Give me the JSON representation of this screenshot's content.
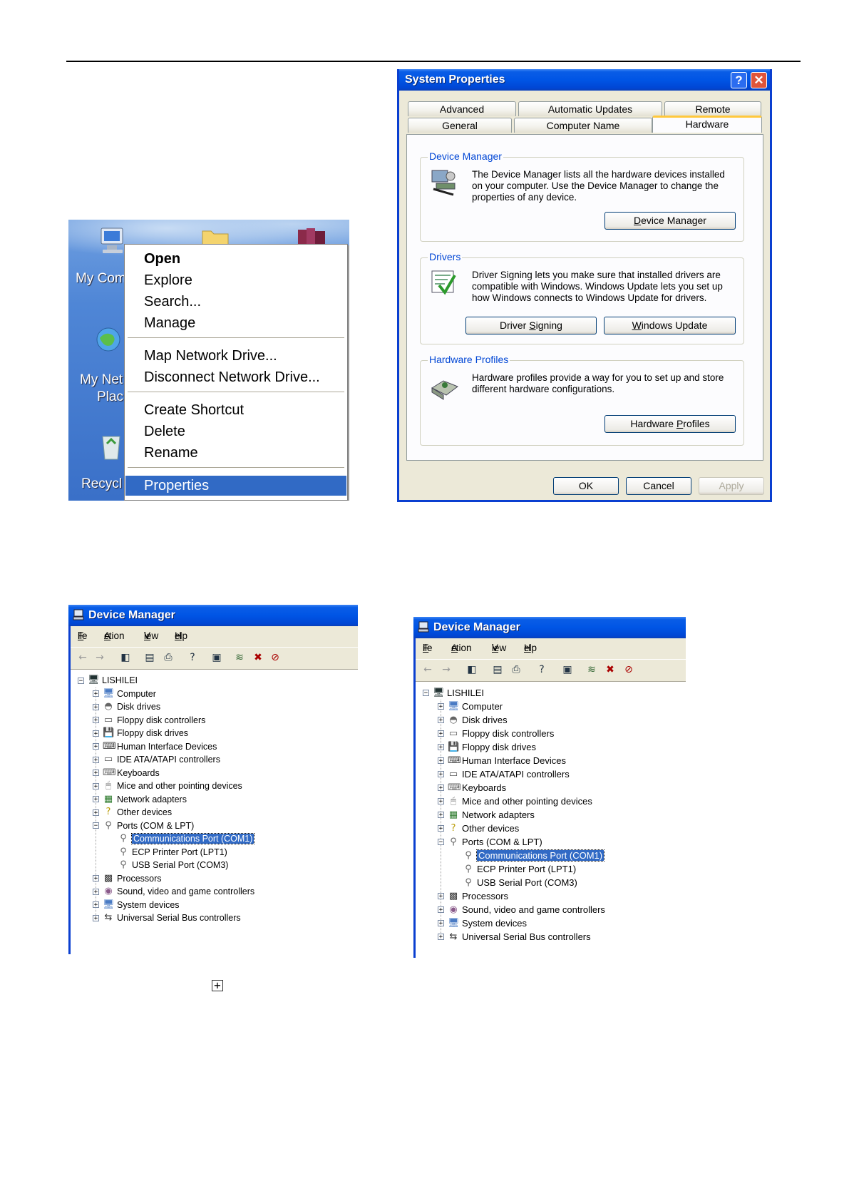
{
  "context_menu": {
    "items": [
      {
        "label": "Open",
        "bold": true
      },
      {
        "label": "Explore"
      },
      {
        "label": "Search..."
      },
      {
        "label": "Manage"
      },
      {
        "label": "Map Network Drive..."
      },
      {
        "label": "Disconnect Network Drive..."
      },
      {
        "label": "Create Shortcut"
      },
      {
        "label": "Delete"
      },
      {
        "label": "Rename"
      },
      {
        "label": "Properties",
        "selected": true
      }
    ],
    "desktop_labels": [
      "My Com",
      "My Net",
      "Plac",
      "Recycl"
    ]
  },
  "system_properties": {
    "title": "System Properties",
    "help_button": "?",
    "close_button": "✕",
    "tabs_back": [
      "Advanced",
      "Automatic Updates",
      "Remote"
    ],
    "tabs_front": [
      "General",
      "Computer Name",
      "Hardware"
    ],
    "active_tab": "Hardware",
    "device_manager": {
      "title": "Device Manager",
      "text": "The Device Manager lists all the hardware devices installed on your computer. Use the Device Manager to change the properties of any device.",
      "button_pre": "",
      "button_u": "D",
      "button_post": "evice Manager"
    },
    "drivers": {
      "title": "Drivers",
      "text": "Driver Signing lets you make sure that installed drivers are compatible with Windows. Windows Update lets you set up how Windows connects to Windows Update for drivers.",
      "signing_pre": "Driver ",
      "signing_u": "S",
      "signing_post": "igning",
      "update_pre": "",
      "update_u": "W",
      "update_post": "indows Update"
    },
    "hardware_profiles": {
      "title": "Hardware Profiles",
      "text": "Hardware profiles provide a way for you to set up and store different hardware configurations.",
      "button_pre": "Hardware ",
      "button_u": "P",
      "button_post": "rofiles"
    },
    "ok_label": "OK",
    "cancel_label": "Cancel",
    "apply_label": "Apply"
  },
  "device_manager_window": {
    "title": "Device Manager",
    "menu": [
      {
        "u": "F",
        "rest": "ile"
      },
      {
        "u": "A",
        "rest": "ction"
      },
      {
        "u": "V",
        "rest": "iew"
      },
      {
        "u": "H",
        "rest": "elp"
      }
    ],
    "root": "LISHILEI",
    "categories": [
      "Computer",
      "Disk drives",
      "Floppy disk controllers",
      "Floppy disk drives",
      "Human Interface Devices",
      "IDE ATA/ATAPI controllers",
      "Keyboards",
      "Mice and other pointing devices",
      "Network adapters",
      "Other devices",
      "Ports (COM & LPT)",
      "Processors",
      "Sound, video and game controllers",
      "System devices",
      "Universal Serial Bus controllers"
    ],
    "ports": [
      "Communications Port (COM1)",
      "ECP Printer Port (LPT1)",
      "USB Serial Port (COM3)"
    ],
    "selected_port": "Communications Port (COM1)"
  },
  "colors": {
    "xp_blue": "#0a3fd0",
    "selection": "#316ac5",
    "dialog_bg": "#ece9d8",
    "group_title": "#0046d5"
  }
}
